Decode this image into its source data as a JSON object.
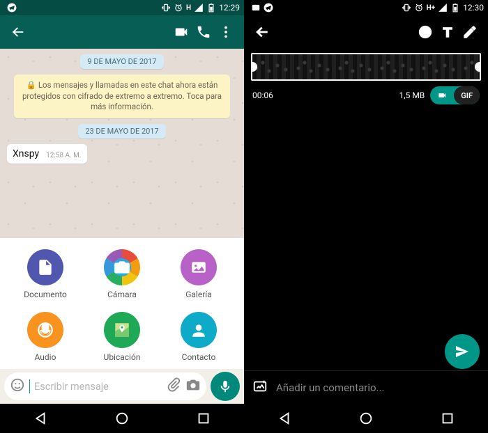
{
  "left": {
    "status": {
      "time": "12:29",
      "network": "H"
    },
    "dates": {
      "d1": "9 DE MAYO DE 2017",
      "d2": "23 DE MAYO DE 2017"
    },
    "e2e": "🔒 Los mensajes y llamadas en este chat ahora están protegidos con cifrado de extremo a extremo. Toca para más información.",
    "msg": {
      "text": "Xnspy",
      "time": "12:58 A. M."
    },
    "attach": {
      "document": "Documento",
      "camera": "Cámara",
      "gallery": "Galería",
      "audio": "Audio",
      "location": "Ubicación",
      "contact": "Contacto",
      "colors": {
        "document": "#5157ae",
        "gallery": "#b861c6",
        "audio": "#f7931e",
        "location": "#1fa855",
        "contact": "#0eabc9"
      }
    },
    "input": {
      "placeholder": "Escribir mensaje"
    }
  },
  "right": {
    "status": {
      "time": "12:30",
      "network": "H+"
    },
    "trim": {
      "duration": "00:06",
      "size": "1,5 MB",
      "gif": "GIF"
    },
    "caption": {
      "placeholder": "Añadir un comentario..."
    }
  }
}
